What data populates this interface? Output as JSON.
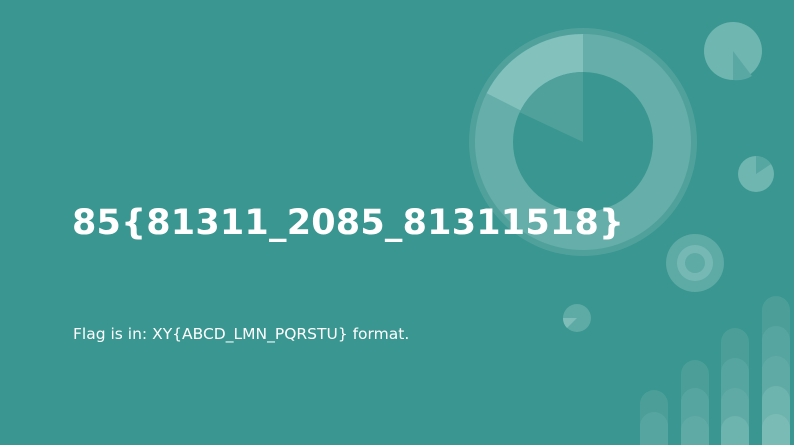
{
  "slide": {
    "title": "85{81311_2085_81311518}",
    "subtitle": "Flag is in: XY{ABCD_LMN_PQRSTU} format."
  },
  "colors": {
    "background": "#399690",
    "text": "#ffffff",
    "decor_light": "#82c1bc",
    "decor_mid": "#66aea9",
    "decor_dark": "#52a39e"
  }
}
